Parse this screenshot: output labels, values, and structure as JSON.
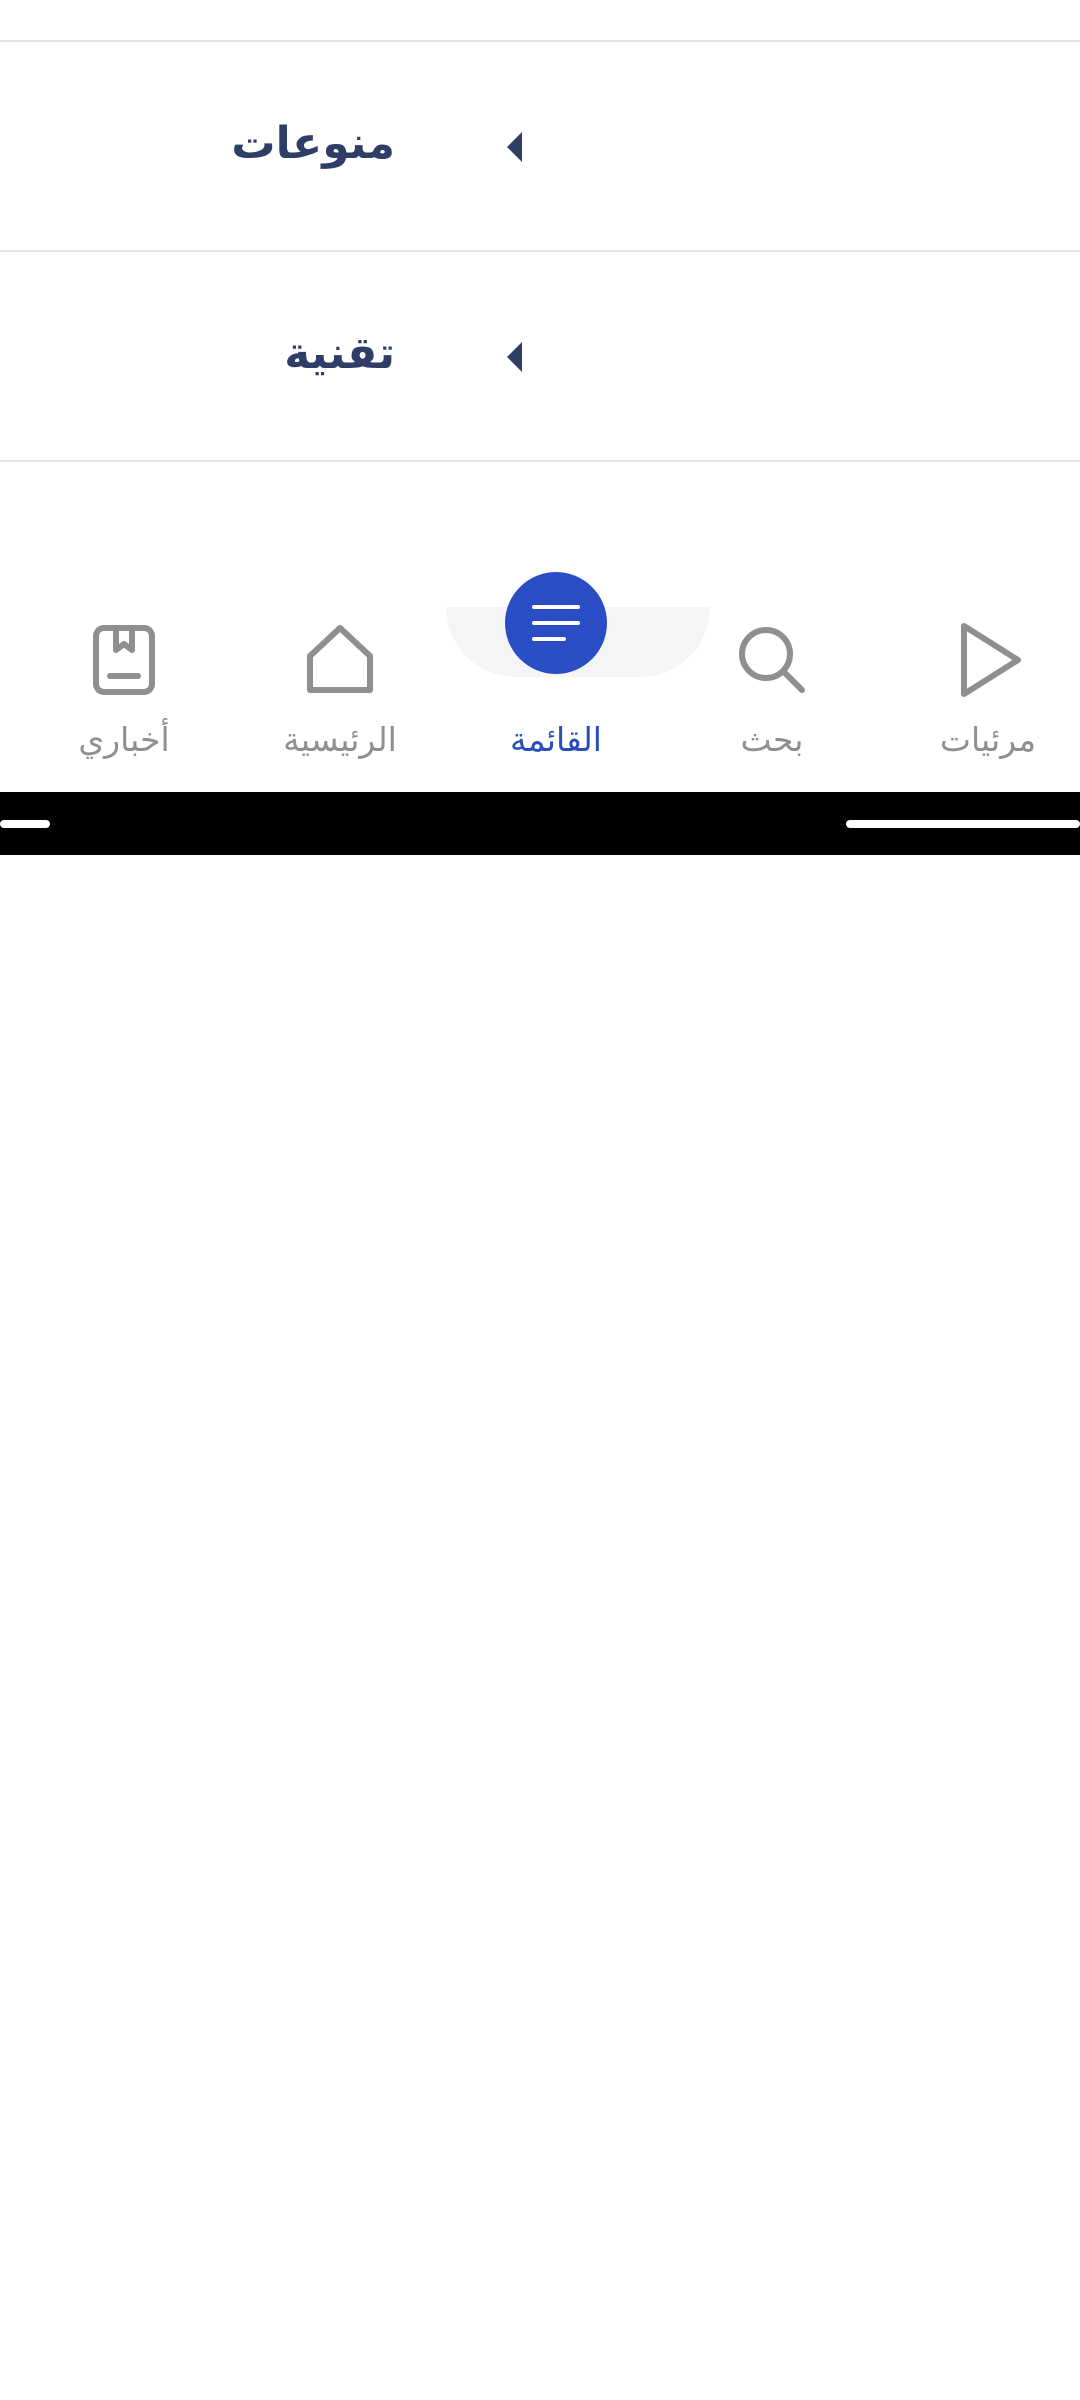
{
  "menu": {
    "items": [
      {
        "label": "منوعات",
        "icon": "caret-left-icon"
      },
      {
        "label": "تقنية",
        "icon": "caret-left-icon"
      }
    ]
  },
  "bottom_nav": {
    "items": [
      {
        "label": "أخباري",
        "icon": "bookmark-book-icon",
        "active": false
      },
      {
        "label": "الرئيسية",
        "icon": "home-icon",
        "active": false
      },
      {
        "label": "القائمة",
        "icon": "menu-lines-icon",
        "active": true
      },
      {
        "label": "بحث",
        "icon": "search-icon",
        "active": false
      },
      {
        "label": "مرئيات",
        "icon": "play-icon",
        "active": false
      }
    ]
  },
  "colors": {
    "accent": "#2a4dc6",
    "menu_text": "#2f3e66",
    "nav_inactive": "#8e8e93",
    "divider": "#e3e3e3"
  }
}
